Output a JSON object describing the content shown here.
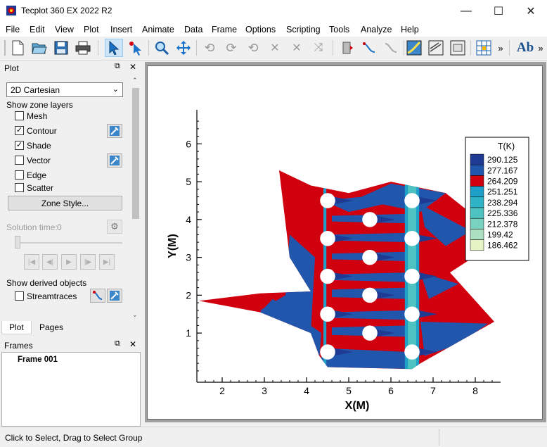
{
  "window": {
    "title": "Tecplot 360 EX 2022 R2",
    "controls": {
      "minimize": "—",
      "maximize": "☐",
      "close": "✕"
    }
  },
  "menu": [
    "File",
    "Edit",
    "View",
    "Plot",
    "Insert",
    "Animate",
    "Data",
    "Frame",
    "Options",
    "Scripting",
    "Tools",
    "Analyze",
    "Help"
  ],
  "toolbar": {
    "overflow": "»",
    "text_tool": "Ab",
    "icons": [
      "new-layout-icon",
      "open-layout-icon",
      "save-icon",
      "print-icon",
      "select-pointer-icon",
      "adjustor-icon",
      "zoom-icon",
      "translate-icon",
      "rotate-x-icon",
      "rotate-y-icon",
      "rotate-z-icon",
      "roll-icon",
      "spherical-rotate-icon",
      "twist-icon",
      "probe-icon",
      "streamtrace-icon",
      "slice-icon",
      "contour-add-icon",
      "contour-remove-icon",
      "iso-surface-icon",
      "grid-tool-icon",
      "text-tool-icon"
    ]
  },
  "plot_panel": {
    "header": "Plot",
    "plot_type": "2D Cartesian",
    "show_zone_layers": "Show zone layers",
    "layers": [
      {
        "label": "Mesh",
        "checked": false
      },
      {
        "label": "Contour",
        "checked": true
      },
      {
        "label": "Shade",
        "checked": true
      },
      {
        "label": "Vector",
        "checked": false
      },
      {
        "label": "Edge",
        "checked": false
      },
      {
        "label": "Scatter",
        "checked": false
      }
    ],
    "zone_style_button": "Zone Style...",
    "solution_time_label": "Solution time:",
    "solution_time_value": "0",
    "show_derived_objects": "Show derived objects",
    "streamtraces_label": "Streamtraces",
    "streamtraces_checked": false
  },
  "tabs": [
    "Plot",
    "Pages"
  ],
  "frames_panel": {
    "header": "Frames",
    "items": [
      "Frame 001"
    ]
  },
  "status": {
    "text": "Click to Select, Drag to Select Group"
  },
  "chart_data": {
    "type": "heatmap",
    "xlabel": "X(M)",
    "ylabel": "Y(M)",
    "xlim": [
      1.4,
      8.6
    ],
    "ylim": [
      -0.3,
      6.9
    ],
    "xticks": [
      2,
      3,
      4,
      5,
      6,
      7,
      8
    ],
    "yticks": [
      1,
      2,
      3,
      4,
      5,
      6
    ],
    "legend": {
      "title": "T(K)",
      "position": "top-right",
      "levels": [
        290.125,
        277.167,
        264.209,
        251.251,
        238.294,
        225.336,
        212.378,
        199.42,
        186.462
      ],
      "level_labels": [
        "290.125",
        "277.167",
        "264.209",
        "251.251",
        "238.294",
        "225.336",
        "212.378",
        "199.42",
        "186.462"
      ],
      "colors": [
        "#1f3a93",
        "#2156ad",
        "#d0000f",
        "#1ea0c8",
        "#2fb3c6",
        "#4cc3c0",
        "#79d1bf",
        "#acdfc2",
        "#e6f3c4"
      ]
    },
    "tube_centers": [
      {
        "x": 4.5,
        "y": 0.5
      },
      {
        "x": 4.5,
        "y": 1.5
      },
      {
        "x": 4.5,
        "y": 2.5
      },
      {
        "x": 4.5,
        "y": 3.5
      },
      {
        "x": 4.5,
        "y": 4.5
      },
      {
        "x": 5.5,
        "y": 1.0
      },
      {
        "x": 5.5,
        "y": 2.0
      },
      {
        "x": 5.5,
        "y": 3.0
      },
      {
        "x": 5.5,
        "y": 4.0
      },
      {
        "x": 6.5,
        "y": 0.5
      },
      {
        "x": 6.5,
        "y": 1.5
      },
      {
        "x": 6.5,
        "y": 2.5
      },
      {
        "x": 6.5,
        "y": 3.5
      },
      {
        "x": 6.5,
        "y": 4.5
      }
    ],
    "tube_radius": 0.18,
    "domain_outline": [
      [
        1.45,
        1.85
      ],
      [
        2.9,
        1.55
      ],
      [
        4.1,
        1.0
      ],
      [
        4.3,
        0.4
      ],
      [
        4.5,
        0.1
      ],
      [
        6.5,
        0.05
      ],
      [
        6.7,
        0.2
      ],
      [
        8.45,
        1.3
      ],
      [
        7.4,
        2.6
      ],
      [
        8.65,
        3.5
      ],
      [
        7.3,
        4.7
      ],
      [
        6.0,
        5.0
      ],
      [
        5.0,
        4.7
      ],
      [
        4.1,
        4.9
      ],
      [
        3.35,
        5.3
      ],
      [
        3.6,
        3.0
      ],
      [
        4.1,
        2.1
      ],
      [
        2.9,
        2.05
      ],
      [
        1.45,
        1.85
      ]
    ]
  }
}
